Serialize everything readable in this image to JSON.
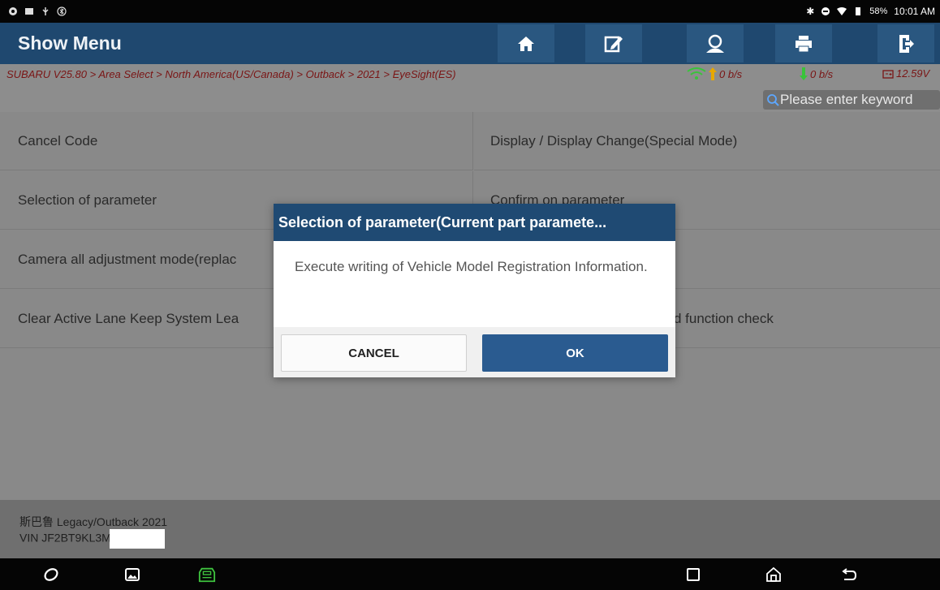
{
  "status_bar": {
    "battery": "58%",
    "time": "10:01 AM"
  },
  "header": {
    "title": "Show Menu",
    "buttons": [
      {
        "icon": "home-icon"
      },
      {
        "icon": "edit-note-icon"
      },
      {
        "icon": "user-icon"
      },
      {
        "icon": "print-icon"
      },
      {
        "icon": "exit-icon"
      }
    ]
  },
  "breadcrumb": {
    "path": "SUBARU V25.80 > Area Select > North America(US/Canada) > Outback > 2021 > EyeSight(ES)",
    "upload_speed": "0 b/s",
    "download_speed": "0 b/s",
    "voltage": "12.59V"
  },
  "search": {
    "placeholder": "Please enter keyword"
  },
  "menu": {
    "items": [
      "Cancel Code",
      "Display / Display Change(Special Mode)",
      "Selection of parameter",
      "Confirm on parameter",
      "Camera all adjustment mode(replac",
      "",
      "Clear Active Lane Keep System Lea",
      "d function check"
    ]
  },
  "footer": {
    "vehicle": "斯巴鲁 Legacy/Outback 2021",
    "vin": "VIN JF2BT9KL3M"
  },
  "dialog": {
    "title": "Selection of parameter(Current part paramete...",
    "message": "Execute writing of Vehicle Model Registration Information.",
    "cancel_label": "CANCEL",
    "ok_label": "OK"
  },
  "colors": {
    "header_bg": "#1f486f",
    "dialog_title_bg": "#1f4a73",
    "ok_button": "#2a5b90",
    "breadcrumb_text": "#7a1515"
  }
}
